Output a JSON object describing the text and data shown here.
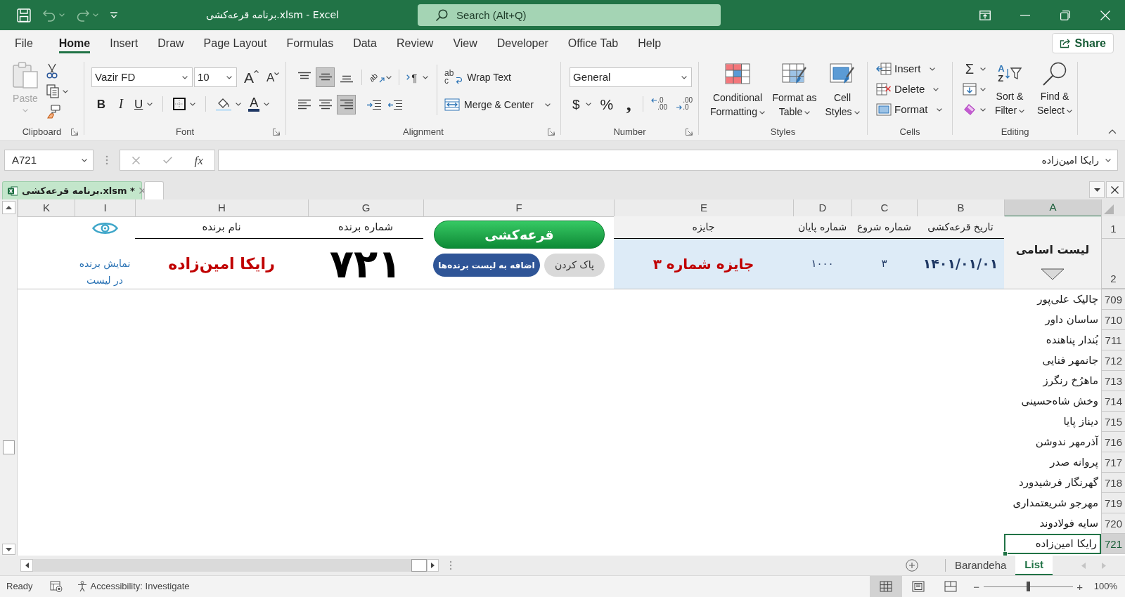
{
  "title_bar": {
    "quick_access": [
      {
        "kind": "save",
        "disabled": false,
        "dropdown": false
      },
      {
        "kind": "undo",
        "disabled": true,
        "dropdown": true
      },
      {
        "kind": "redo",
        "disabled": true,
        "dropdown": true
      },
      {
        "kind": "customize",
        "disabled": false,
        "dropdown": false
      }
    ],
    "title": "برنامه قرعه‌کشی.xlsm - Excel",
    "search": {
      "placeholder": "Search (Alt+Q)"
    },
    "window_controls": [
      {
        "kind": "ribbon-display"
      },
      {
        "kind": "minimize"
      },
      {
        "kind": "restore"
      },
      {
        "kind": "close"
      }
    ]
  },
  "ribbon": {
    "tabs": [
      {
        "label": "Help",
        "selected": false
      },
      {
        "label": "Office Tab",
        "selected": false
      },
      {
        "label": "Developer",
        "selected": false
      },
      {
        "label": "View",
        "selected": false
      },
      {
        "label": "Review",
        "selected": false
      },
      {
        "label": "Data",
        "selected": false
      },
      {
        "label": "Formulas",
        "selected": false
      },
      {
        "label": "Page Layout",
        "selected": false
      },
      {
        "label": "Draw",
        "selected": false
      },
      {
        "label": "Insert",
        "selected": false
      },
      {
        "label": "Home",
        "selected": true
      },
      {
        "label": "File",
        "selected": false
      }
    ],
    "share": {
      "label": "Share"
    },
    "groups": [
      {
        "kind": "editing",
        "label": "Editing",
        "launcher": false,
        "small_buttons": [
          {
            "kind": "autosum",
            "glyph": "Σ"
          },
          {
            "kind": "fill"
          },
          {
            "kind": "clear"
          }
        ],
        "large_buttons": [
          {
            "kind": "find-select",
            "label": "Find & Select"
          },
          {
            "kind": "sort-filter",
            "label": "Sort & Filter",
            "glyph_lines": [
              "A",
              "Z"
            ]
          }
        ]
      },
      {
        "kind": "cells",
        "label": "Cells",
        "launcher": false,
        "buttons": [
          {
            "kind": "insert",
            "label": "Insert"
          },
          {
            "kind": "delete",
            "label": "Delete"
          },
          {
            "kind": "format",
            "label": "Format"
          }
        ]
      },
      {
        "kind": "styles",
        "label": "Styles",
        "launcher": false,
        "buttons": [
          {
            "kind": "cell-styles",
            "label": "Cell Styles"
          },
          {
            "kind": "format-as-table",
            "label": "Format as Table"
          },
          {
            "kind": "conditional-formatting",
            "label": "Conditional Formatting"
          }
        ]
      },
      {
        "kind": "number",
        "label": "Number",
        "launcher": true,
        "format": "General",
        "buttons": [
          {
            "kind": "decrease-decimal",
            "glyph_lines": [
              ".00",
              ".0"
            ],
            "dropdown": false
          },
          {
            "kind": "increase-decimal",
            "glyph_lines": [
              ".0",
              ".00"
            ],
            "dropdown": false
          },
          {
            "kind": "comma",
            "glyph": ",",
            "dropdown": false
          },
          {
            "kind": "percent",
            "glyph": "%",
            "dropdown": false
          },
          {
            "kind": "currency",
            "glyph": "$",
            "dropdown": true
          }
        ]
      },
      {
        "kind": "alignment",
        "label": "Alignment",
        "launcher": true,
        "vertical": [
          {
            "kind": "top",
            "selected": false
          },
          {
            "kind": "middle",
            "selected": true
          },
          {
            "kind": "bottom",
            "selected": false
          }
        ],
        "orientation": {
          "glyph": "ab"
        },
        "text_direction": {
          "glyph": "¶"
        },
        "horizontal": [
          {
            "kind": "left",
            "selected": false
          },
          {
            "kind": "center",
            "selected": false
          },
          {
            "kind": "right",
            "selected": true
          }
        ],
        "indent": [
          {
            "kind": "decrease"
          },
          {
            "kind": "increase"
          }
        ],
        "wrap_text": {
          "label": "Wrap Text",
          "glyph_lines": [
            "ab",
            "c"
          ]
        },
        "merge": {
          "label": "Merge & Center"
        }
      },
      {
        "kind": "font",
        "label": "Font",
        "launcher": true,
        "font_name": "Vazir FD",
        "font_size": "10",
        "size_buttons": [
          {
            "kind": "shrink",
            "glyph": "A"
          },
          {
            "kind": "grow",
            "glyph": "A"
          }
        ],
        "format_buttons": [
          {
            "kind": "font-color",
            "glyph": "A",
            "dropdown": true
          },
          {
            "kind": "fill-color",
            "dropdown": true
          },
          {
            "kind": "borders",
            "dropdown": true
          },
          {
            "kind": "underline",
            "glyph": "U",
            "dropdown": true
          },
          {
            "kind": "italic",
            "glyph": "I",
            "dropdown": false
          },
          {
            "kind": "bold",
            "glyph": "B",
            "dropdown": false
          }
        ]
      },
      {
        "kind": "clipboard",
        "label": "Clipboard",
        "launcher": true,
        "paste": {
          "label": "Paste",
          "disabled": true
        },
        "tools": [
          {
            "kind": "cut",
            "dropdown": false
          },
          {
            "kind": "copy",
            "dropdown": true
          },
          {
            "kind": "format-painter",
            "dropdown": false
          }
        ]
      }
    ]
  },
  "formula_bar": {
    "name_box": "A721",
    "buttons": [
      {
        "kind": "cancel",
        "disabled": true
      },
      {
        "kind": "enter",
        "disabled": true
      },
      {
        "kind": "insert-function",
        "glyph": "fx",
        "disabled": false
      }
    ],
    "content": "رایکا امین‌زاده"
  },
  "document_tabs": [
    {
      "label": "برنامه قرعه‌کشی.xlsm *",
      "selected": true
    }
  ],
  "sheet": {
    "columns": [
      {
        "label": "A",
        "selected": true
      },
      {
        "label": "B",
        "selected": false
      },
      {
        "label": "C",
        "selected": false
      },
      {
        "label": "D",
        "selected": false
      },
      {
        "label": "E",
        "selected": false
      },
      {
        "label": "F",
        "selected": false
      },
      {
        "label": "G",
        "selected": false
      },
      {
        "label": "H",
        "selected": false
      },
      {
        "label": "I",
        "selected": false
      },
      {
        "label": "K",
        "selected": false
      }
    ],
    "top_rows": [
      {
        "label": "1",
        "selected": false
      },
      {
        "label": "2",
        "selected": false
      }
    ],
    "list_title": "لیست اسامی",
    "draw_fields": [
      {
        "heading": "تاریخ قرعه‌کشی",
        "value": "۱۴۰۱/۰۱/۰۱",
        "kind": "date"
      },
      {
        "heading": "شماره شروع",
        "value": "۳",
        "kind": "number"
      },
      {
        "heading": "شماره پایان",
        "value": "۱۰۰۰",
        "kind": "number"
      },
      {
        "heading": "جایزه",
        "value": "جایزه شماره ۳",
        "kind": "prize"
      }
    ],
    "buttons": [
      {
        "label": "قرعه‌کشی",
        "kind": "draw"
      },
      {
        "label": "پاک کردن",
        "kind": "clear"
      },
      {
        "label": "اضافه به لیست برنده‌ها",
        "kind": "add"
      }
    ],
    "winner": {
      "number_heading": "شماره برنده",
      "number": "۷۲۱",
      "name_heading": "نام برنده",
      "name": "رایکا امین‌زاده"
    },
    "show_in_list": "نمایش برنده در لیست",
    "list_rows": [
      {
        "label": "709",
        "name": "چالیک علی‌پور",
        "selected": false
      },
      {
        "label": "710",
        "name": "ساسان داور",
        "selected": false
      },
      {
        "label": "711",
        "name": "بُندار پناهنده",
        "selected": false
      },
      {
        "label": "712",
        "name": "جانمهر فنایی",
        "selected": false
      },
      {
        "label": "713",
        "name": "ماهرُخ رنگرز",
        "selected": false
      },
      {
        "label": "714",
        "name": "وخش شاه‌حسینی",
        "selected": false
      },
      {
        "label": "715",
        "name": "دیناز پایا",
        "selected": false
      },
      {
        "label": "716",
        "name": "آذرمهر ندوشن",
        "selected": false
      },
      {
        "label": "717",
        "name": "پروانه صدر",
        "selected": false
      },
      {
        "label": "718",
        "name": "گهرنگار فرشیدورد",
        "selected": false
      },
      {
        "label": "719",
        "name": "مهرجو شریعتمداری",
        "selected": false
      },
      {
        "label": "720",
        "name": "سایه فولادوند",
        "selected": false
      },
      {
        "label": "721",
        "name": "رایکا امین‌زاده",
        "selected": true
      }
    ]
  },
  "sheet_tabs": {
    "tabs": [
      {
        "label": "List",
        "selected": true
      },
      {
        "label": "Barandeha",
        "selected": false
      }
    ],
    "navigation": [
      {
        "kind": "previous",
        "disabled": true
      },
      {
        "kind": "next",
        "disabled": true
      }
    ]
  },
  "status_bar": {
    "status": "Ready",
    "accessibility": "Accessibility: Investigate",
    "views": [
      {
        "kind": "normal",
        "selected": true
      },
      {
        "kind": "page-layout",
        "selected": false
      },
      {
        "kind": "page-break-preview",
        "selected": false
      }
    ],
    "zoom": {
      "minus": "−",
      "plus": "+",
      "level": 0.5,
      "reading": "100%"
    }
  }
}
